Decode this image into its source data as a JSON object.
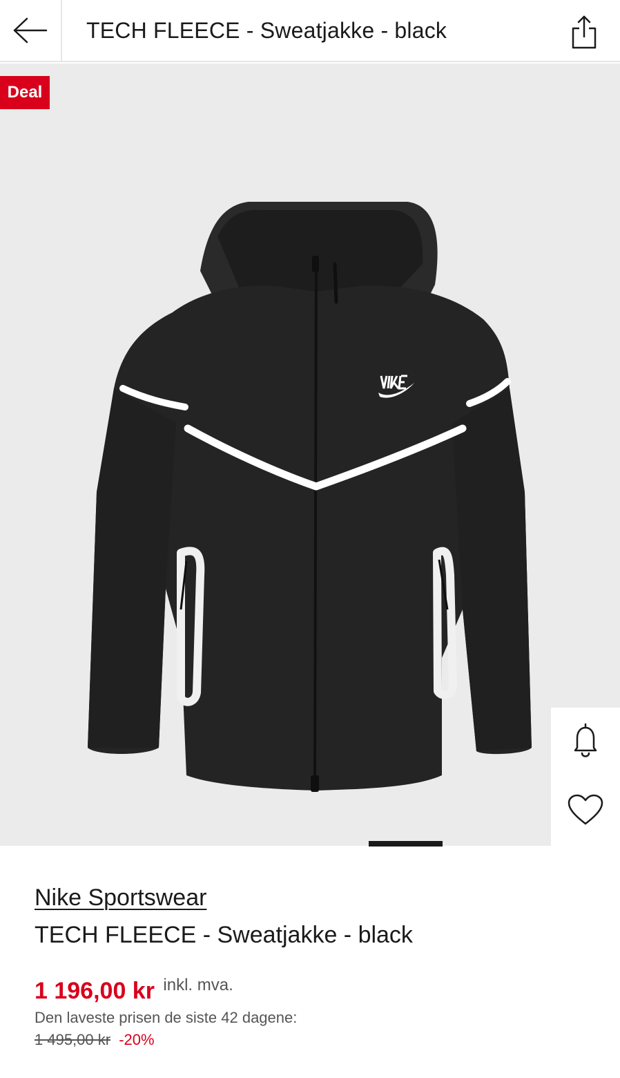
{
  "header": {
    "back_icon": "arrow-left-icon",
    "title": "TECH FLEECE - Sweatjakke - black",
    "share_icon": "share-icon"
  },
  "gallery": {
    "badge": "Deal",
    "image_subject": "black hooded zip jacket with white chevron stripes",
    "slide_count": 1,
    "active_slide": 1,
    "side_actions": {
      "notify_icon": "bell-icon",
      "wishlist_icon": "heart-icon"
    }
  },
  "product": {
    "brand": "Nike Sportswear",
    "name": "TECH FLEECE - Sweatjakke - black",
    "price": "1 196,00 kr",
    "vat_note": "inkl. mva.",
    "lowest_price_label": "Den laveste prisen de siste 42 dagene:",
    "old_price": "1 495,00 kr",
    "discount": "-20%"
  },
  "colors": {
    "accent_red": "#d9001b",
    "text": "#1a1a1a",
    "muted": "#555555",
    "image_bg": "#ebebeb"
  }
}
